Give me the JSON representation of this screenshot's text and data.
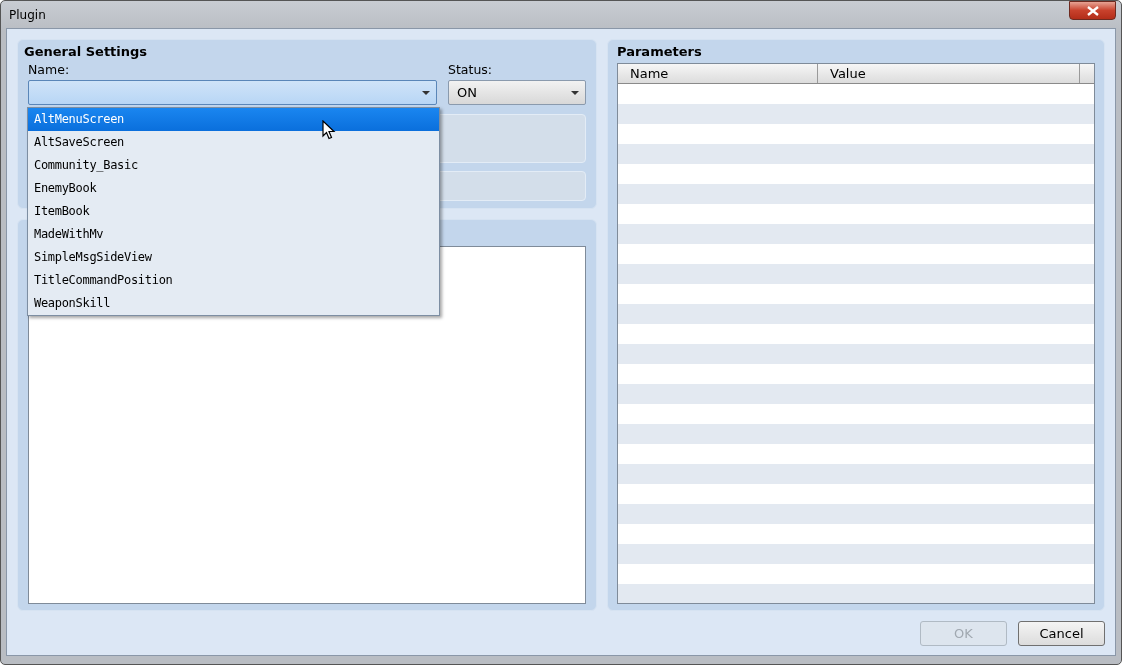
{
  "window": {
    "title": "Plugin"
  },
  "general_settings": {
    "title": "General Settings",
    "name_label": "Name:",
    "status_label": "Status:",
    "status_value": "ON",
    "name_dropdown": {
      "expanded": true,
      "items": [
        {
          "label": "AltMenuScreen",
          "selected": true
        },
        {
          "label": "AltSaveScreen",
          "selected": false
        },
        {
          "label": "Community_Basic",
          "selected": false
        },
        {
          "label": "EnemyBook",
          "selected": false
        },
        {
          "label": "ItemBook",
          "selected": false
        },
        {
          "label": "MadeWithMv",
          "selected": false
        },
        {
          "label": "SimpleMsgSideView",
          "selected": false
        },
        {
          "label": "TitleCommandPosition",
          "selected": false
        },
        {
          "label": "WeaponSkill",
          "selected": false
        }
      ]
    }
  },
  "parameters": {
    "title": "Parameters",
    "columns": [
      "Name",
      "Value"
    ]
  },
  "buttons": [
    {
      "label": "OK",
      "disabled": true
    },
    {
      "label": "Cancel",
      "disabled": false
    }
  ]
}
